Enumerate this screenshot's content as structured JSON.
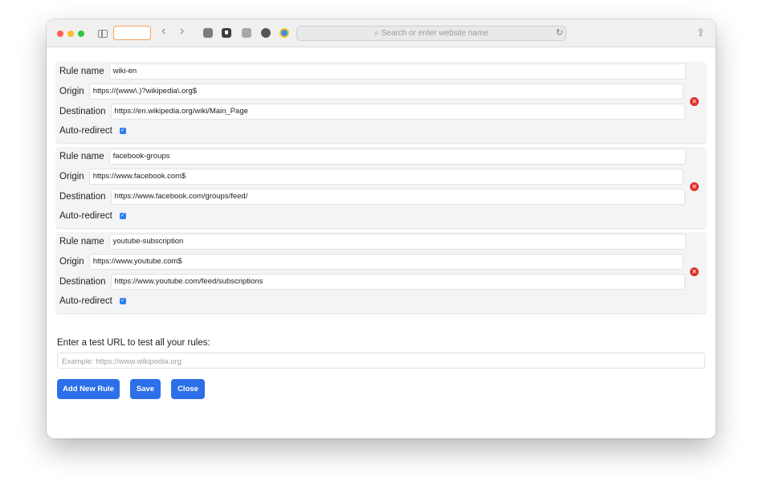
{
  "browser": {
    "url_placeholder": "Search or enter website name"
  },
  "rules": [
    {
      "name_label": "Rule name",
      "name": "wiki-en",
      "origin_label": "Origin",
      "origin": "https://(www\\.)?wikipedia\\.org$",
      "destination_label": "Destination",
      "destination": "https://en.wikipedia.org/wiki/Main_Page",
      "auto_label": "Auto-redirect",
      "auto_redirect": true
    },
    {
      "name_label": "Rule name",
      "name": "facebook-groups",
      "origin_label": "Origin",
      "origin": "https://www.facebook.com$",
      "destination_label": "Destination",
      "destination": "https://www.facebook.com/groups/feed/",
      "auto_label": "Auto-redirect",
      "auto_redirect": true
    },
    {
      "name_label": "Rule name",
      "name": "youtube-subscription",
      "origin_label": "Origin",
      "origin": "https://www.youtube.com$",
      "destination_label": "Destination",
      "destination": "https://www.youtube.com/feed/subscriptions",
      "auto_label": "Auto-redirect",
      "auto_redirect": true
    }
  ],
  "test": {
    "label": "Enter a test URL to test all your rules:",
    "placeholder": "Example: https://www.wikipedia.org"
  },
  "actions": {
    "add_label": "Add New Rule",
    "save_label": "Save",
    "close_label": "Close"
  },
  "colors": {
    "accent": "#2d6fe9",
    "delete": "#e0322b"
  }
}
